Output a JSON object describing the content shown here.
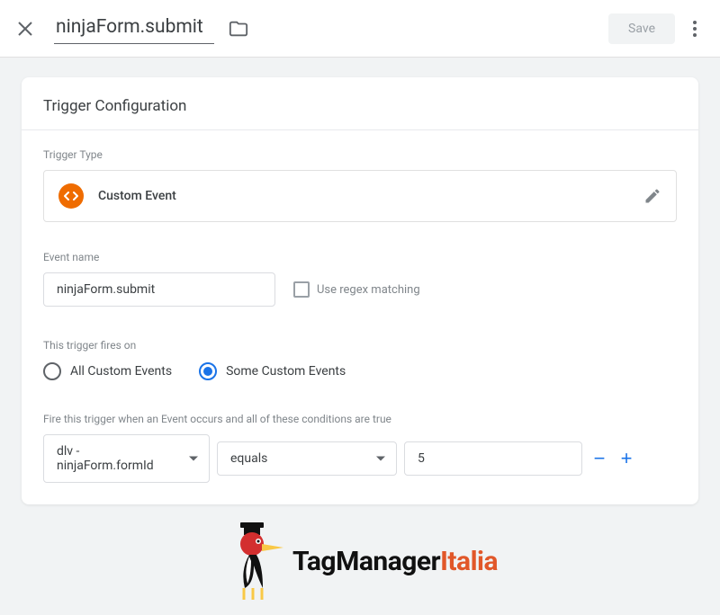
{
  "header": {
    "title": "ninjaForm.submit",
    "save_label": "Save"
  },
  "card": {
    "title": "Trigger Configuration",
    "trigger_type_label": "Trigger Type",
    "trigger_type_name": "Custom Event",
    "event_name_label": "Event name",
    "event_name_value": "ninjaForm.submit",
    "regex_label": "Use regex matching",
    "fires_on_label": "This trigger fires on",
    "radio_all": "All Custom Events",
    "radio_some": "Some Custom Events",
    "condition_hint": "Fire this trigger when an Event occurs and all of these conditions are true",
    "condition": {
      "variable": "dlv - ninjaForm.formId",
      "operator": "equals",
      "value": "5"
    }
  },
  "brand": {
    "text1": "TagManager",
    "text2": "Italia"
  }
}
